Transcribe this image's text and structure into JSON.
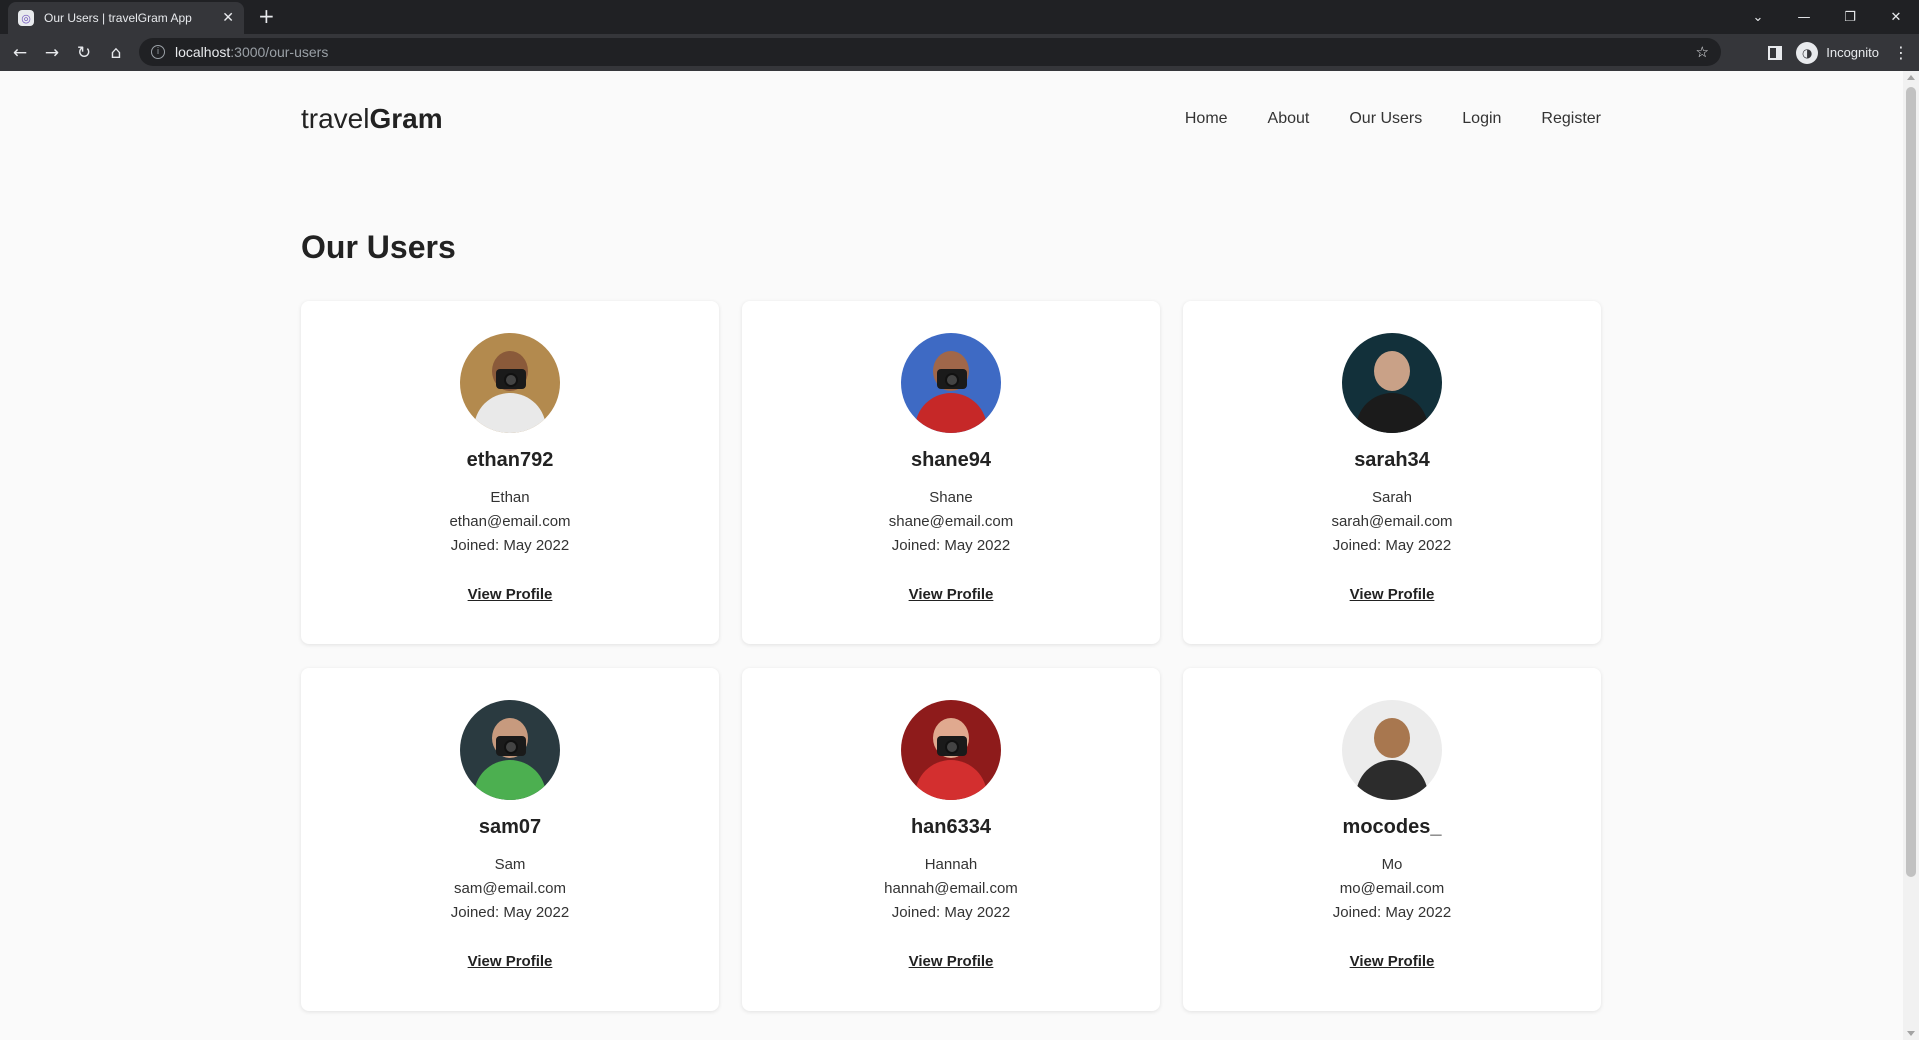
{
  "browser": {
    "tab_title": "Our Users | travelGram App",
    "url_host": "localhost",
    "url_path": ":3000/our-users",
    "profile_label": "Incognito"
  },
  "site": {
    "logo_light": "travel",
    "logo_bold": "Gram",
    "nav": [
      "Home",
      "About",
      "Our Users",
      "Login",
      "Register"
    ]
  },
  "page": {
    "title": "Our Users"
  },
  "users": [
    {
      "username": "ethan792",
      "name": "Ethan",
      "email": "ethan@email.com",
      "joined": "Joined: May 2022",
      "link": "View Profile",
      "bg": "#b38a4e",
      "skin": "#8a5a3a",
      "shirt": "#e9e9e9"
    },
    {
      "username": "shane94",
      "name": "Shane",
      "email": "shane@email.com",
      "joined": "Joined: May 2022",
      "link": "View Profile",
      "bg": "#3e6ac4",
      "skin": "#a0674a",
      "shirt": "#c62828"
    },
    {
      "username": "sarah34",
      "name": "Sarah",
      "email": "sarah@email.com",
      "joined": "Joined: May 2022",
      "link": "View Profile",
      "bg": "#12303a",
      "skin": "#c9a187",
      "shirt": "#1b1b1b"
    },
    {
      "username": "sam07",
      "name": "Sam",
      "email": "sam@email.com",
      "joined": "Joined: May 2022",
      "link": "View Profile",
      "bg": "#2a3a40",
      "skin": "#c79a7e",
      "shirt": "#4caf50"
    },
    {
      "username": "han6334",
      "name": "Hannah",
      "email": "hannah@email.com",
      "joined": "Joined: May 2022",
      "link": "View Profile",
      "bg": "#8e1b1b",
      "skin": "#e0a98f",
      "shirt": "#d32f2f"
    },
    {
      "username": "mocodes_",
      "name": "Mo",
      "email": "mo@email.com",
      "joined": "Joined: May 2022",
      "link": "View Profile",
      "bg": "#ececec",
      "skin": "#a8774f",
      "shirt": "#2c2c2c"
    }
  ]
}
